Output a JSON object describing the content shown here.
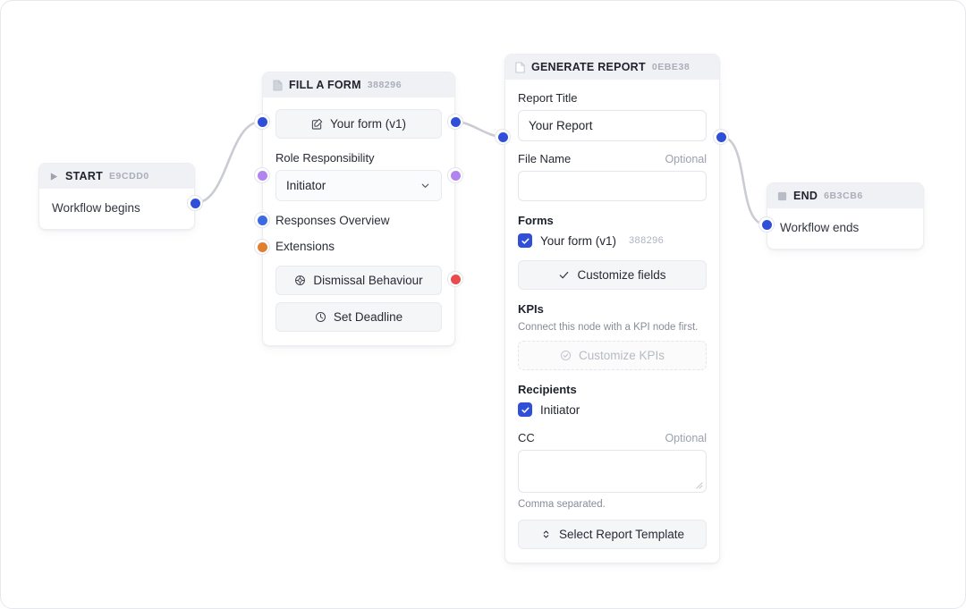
{
  "canvas": {
    "background": "#ffffff",
    "accent": "#2f4fd8"
  },
  "nodes": {
    "start": {
      "title": "START",
      "id": "E9CDD0",
      "icon": "play-icon",
      "text": "Workflow begins"
    },
    "fill_a_form": {
      "title": "FILL A FORM",
      "id": "388296",
      "icon": "document-icon",
      "form_button": {
        "label": "Your form (v1)",
        "icon": "pencil-square-icon"
      },
      "role_label": "Role Responsibility",
      "role_value": "Initiator",
      "role_options": [
        "Initiator"
      ],
      "responses_overview": "Responses Overview",
      "extensions": "Extensions",
      "dismissal_button": {
        "label": "Dismissal Behaviour",
        "icon": "gear-clock-icon"
      },
      "deadline_button": {
        "label": "Set Deadline",
        "icon": "clock-icon"
      }
    },
    "generate_report": {
      "title": "GENERATE REPORT",
      "id": "0EBE38",
      "icon": "document-icon",
      "report_title_label": "Report Title",
      "report_title_value": "Your Report",
      "file_name_label": "File Name",
      "file_name_optional": "Optional",
      "file_name_value": "",
      "forms_label": "Forms",
      "form_checkbox_label": "Your form (v1)",
      "form_checkbox_id": "388296",
      "customize_fields_button": {
        "label": "Customize fields",
        "icon": "check-icon"
      },
      "kpis_label": "KPIs",
      "kpis_hint": "Connect this node with a KPI node first.",
      "customize_kpis_button": {
        "label": "Customize KPIs",
        "icon": "check-circle-icon",
        "disabled": true
      },
      "recipients_label": "Recipients",
      "recipient_checkbox_label": "Initiator",
      "cc_label": "CC",
      "cc_optional": "Optional",
      "cc_value": "",
      "cc_hint": "Comma separated.",
      "select_template_button": {
        "label": "Select Report Template",
        "icon": "updown-chevrons-icon"
      }
    },
    "end": {
      "title": "END",
      "id": "6B3CB6",
      "icon": "square-icon",
      "text": "Workflow ends"
    }
  }
}
